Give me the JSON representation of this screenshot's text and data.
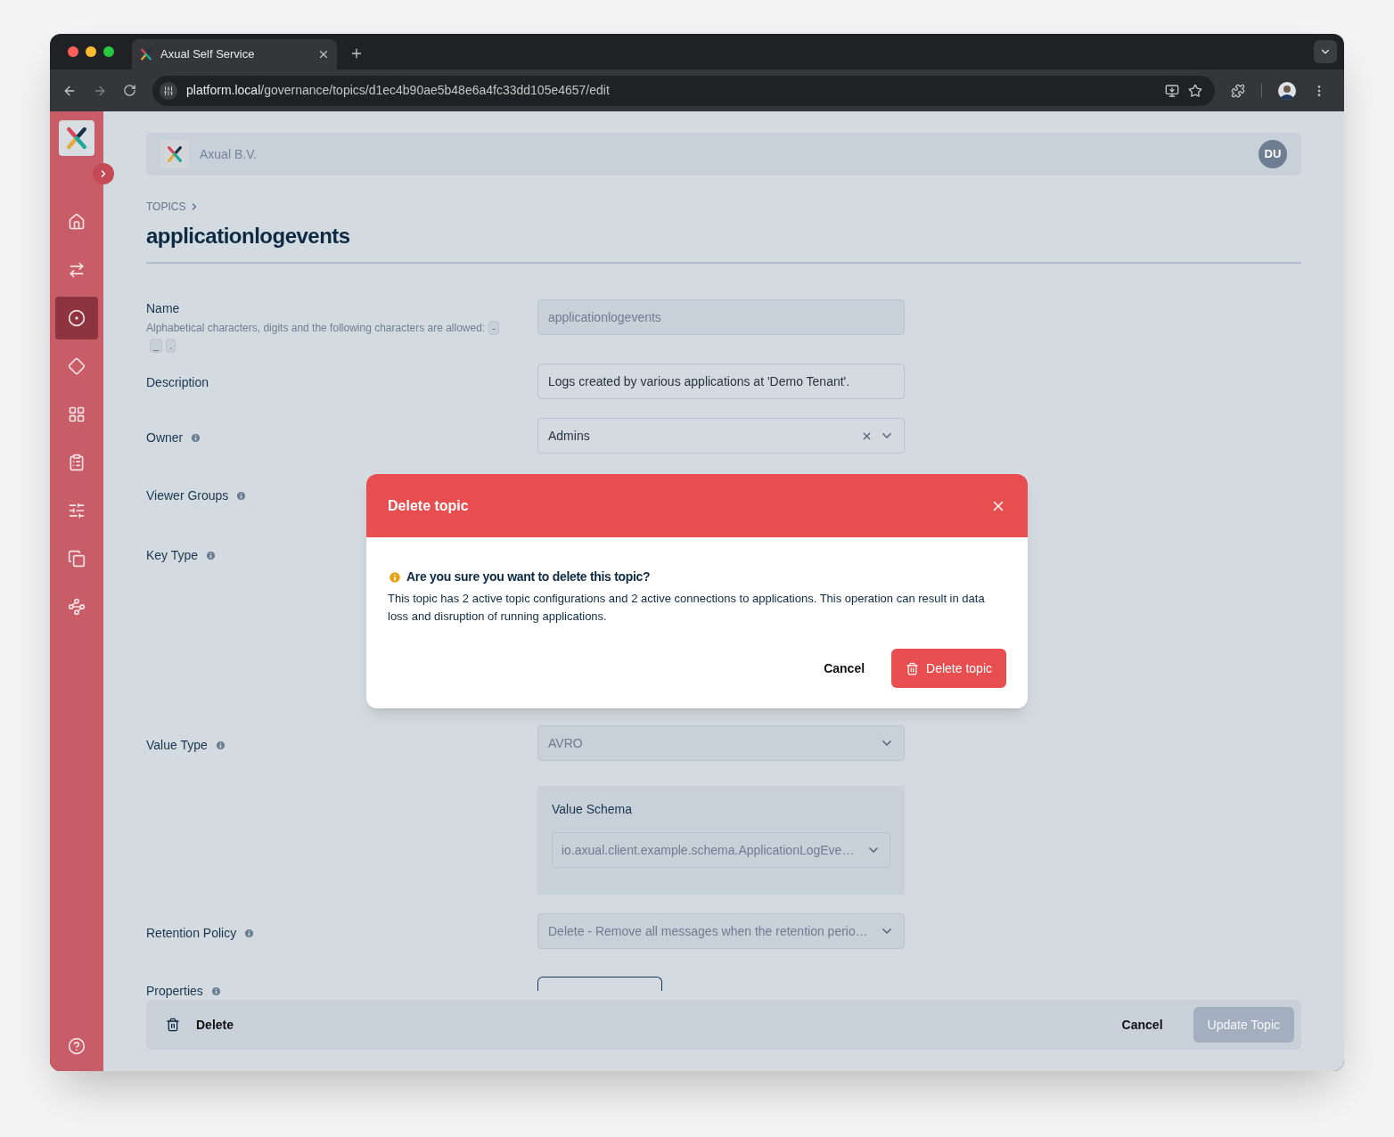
{
  "browser": {
    "tab_title": "Axual Self Service",
    "url_host": "platform.local",
    "url_path": "/governance/topics/d1ec4b90ae5b48e6a4fc33dd105e4657/edit"
  },
  "sidebar": {
    "items": [
      {
        "selected": false
      },
      {
        "selected": false
      },
      {
        "selected": true
      },
      {
        "selected": false
      },
      {
        "selected": false
      },
      {
        "selected": false
      },
      {
        "selected": false
      },
      {
        "selected": false
      },
      {
        "selected": false
      }
    ]
  },
  "header": {
    "organization": "Axual B.V.",
    "avatar": "DU"
  },
  "breadcrumb": [
    "TOPICS"
  ],
  "title": "applicationlogevents",
  "fields": [
    {
      "kind": "text",
      "label": "Name",
      "hint": "Alphabetical characters, digits and the following characters are allowed:",
      "allowed": [
        "-",
        "_",
        "."
      ],
      "value": "applicationlogevents",
      "disabled": true
    },
    {
      "kind": "text",
      "label": "Description",
      "value": "Logs created by various applications at 'Demo Tenant'.",
      "disabled": false
    },
    {
      "kind": "select",
      "label": "Owner",
      "info": true,
      "value": "Admins",
      "clearable": true,
      "disabled": false
    },
    {
      "kind": "covered",
      "label": "Viewer Groups",
      "info": true
    },
    {
      "kind": "covered",
      "label": "Key Type",
      "info": true
    },
    {
      "kind": "select",
      "label": "Value Type",
      "info": true,
      "value": "AVRO",
      "clearable": false,
      "disabled": true
    },
    {
      "kind": "schema",
      "title": "Value Schema",
      "value": "io.axual.client.example.schema.ApplicationLogEve…",
      "disabled": true
    },
    {
      "kind": "select",
      "label": "Retention Policy",
      "info": true,
      "value": "Delete - Remove all messages when the retention perio…",
      "clearable": false,
      "disabled": true
    },
    {
      "kind": "button",
      "label": "Properties",
      "info": true
    }
  ],
  "footer": {
    "delete": "Delete",
    "cancel": "Cancel",
    "submit": "Update Topic",
    "submit_disabled": true
  },
  "dialog": {
    "title": "Delete topic",
    "question": "Are you sure you want to delete this topic?",
    "message": "This topic has 2 active topic configurations and 2 active connections to applications. This operation can result in data loss and disruption of running applications.",
    "cancel": "Cancel",
    "confirm": "Delete topic"
  }
}
